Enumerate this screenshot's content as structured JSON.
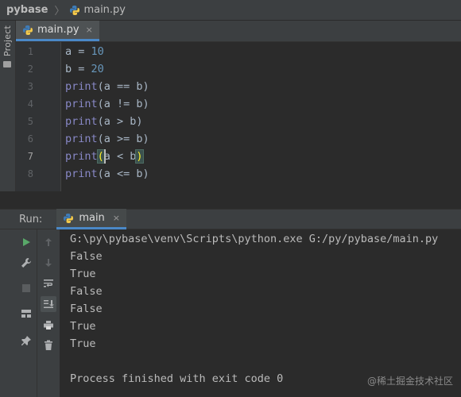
{
  "navbar": {
    "project": "pybase",
    "file": "main.py"
  },
  "project_tab": {
    "label": "Project"
  },
  "editor": {
    "tab_label": "main.py",
    "tab_close": "×",
    "lines": [
      {
        "n": "1",
        "text": "a = 10"
      },
      {
        "n": "2",
        "text": "b = 20"
      },
      {
        "n": "3",
        "text": "print(a == b)"
      },
      {
        "n": "4",
        "text": "print(a != b)"
      },
      {
        "n": "5",
        "text": "print(a > b)"
      },
      {
        "n": "6",
        "text": "print(a >= b)"
      },
      {
        "n": "7",
        "text": "print(a < b)"
      },
      {
        "n": "8",
        "text": "print(a <= b)"
      }
    ],
    "current_line": "7"
  },
  "run": {
    "header_label": "Run:",
    "tab_label": "main",
    "tab_close": "×",
    "toolbar_icons": [
      "run-icon",
      "wrench-icon",
      "stop-icon",
      "layout-icon",
      "pin-icon",
      "up-arrow-icon",
      "down-arrow-icon",
      "soft-wrap-icon",
      "scroll-to-end-icon",
      "print-icon",
      "trash-icon"
    ]
  },
  "console": {
    "command": "G:\\py\\pybase\\venv\\Scripts\\python.exe G:/py/pybase/main.py",
    "outputs": [
      "False",
      "True",
      "False",
      "False",
      "True",
      "True"
    ],
    "exit_message": "Process finished with exit code 0"
  },
  "watermark": "@稀土掘金技术社区",
  "colors": {
    "background": "#2b2b2b",
    "panel": "#3c3f41",
    "keyword": "#8888c6",
    "number": "#6897bb",
    "text": "#a9b7c6",
    "accent": "#4a88c7",
    "run_green": "#59a869"
  }
}
